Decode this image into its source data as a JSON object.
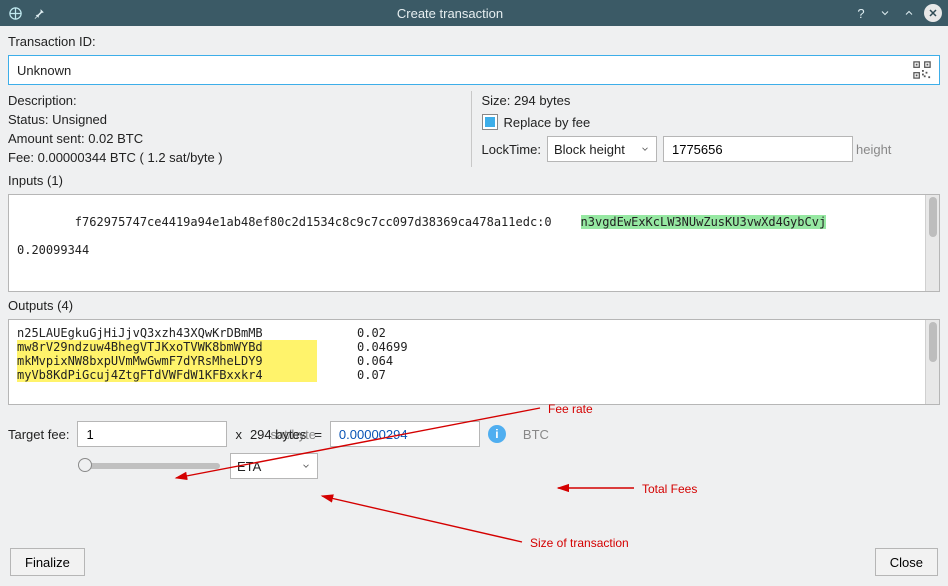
{
  "window": {
    "title": "Create transaction"
  },
  "tx": {
    "id_label": "Transaction ID:",
    "id_value": "Unknown",
    "desc_label": "Description:",
    "status_label": "Status: Unsigned",
    "amount_label": "Amount sent: 0.02 BTC",
    "fee_label": "Fee: 0.00000344 BTC  ( 1.2 sat/byte )",
    "size_label": "Size: 294 bytes",
    "rbf_label": "Replace by fee",
    "locktime_label": "LockTime:",
    "locktime_type": "Block height",
    "locktime_value": "1775656",
    "locktime_suffix": "height"
  },
  "inputs": {
    "header": "Inputs (1)",
    "txref": "f762975747ce4419a94e1ab48ef80c2d1534c8c9c7cc097d38369ca478a11edc:0",
    "addr": "n3vgdEwExKcLW3NUwZusKU3vwXd4GybCvj",
    "amount": "0.20099344"
  },
  "outputs": {
    "header": "Outputs (4)",
    "rows": [
      {
        "addr": "n25LAUEgkuGjHiJjvQ3xzh43XQwKrDBmMB",
        "val": "0.02",
        "hl": false
      },
      {
        "addr": "mw8rV29ndzuw4BhegVTJKxoTVWK8bmWYBd",
        "val": "0.04699",
        "hl": true
      },
      {
        "addr": "mkMvpixNW8bxpUVmMwGwmF7dYRsMheLDY9",
        "val": "0.064",
        "hl": true
      },
      {
        "addr": "myVb8KdPiGcuj4ZtgFTdVWFdW1KFBxxkr4",
        "val": "0.07",
        "hl": true
      }
    ]
  },
  "target": {
    "label": "Target fee:",
    "fee_value": "1",
    "fee_suffix": "sat/byte",
    "mult": "x",
    "size_text": "294 bytes",
    "equals": "=",
    "total_value": "0.00000294",
    "total_suffix": "BTC",
    "mode": "ETA"
  },
  "buttons": {
    "finalize": "Finalize",
    "close": "Close"
  },
  "annotations": {
    "fee_rate": "Fee rate",
    "total_fees": "Total Fees",
    "size_of_tx": "Size of transaction"
  }
}
